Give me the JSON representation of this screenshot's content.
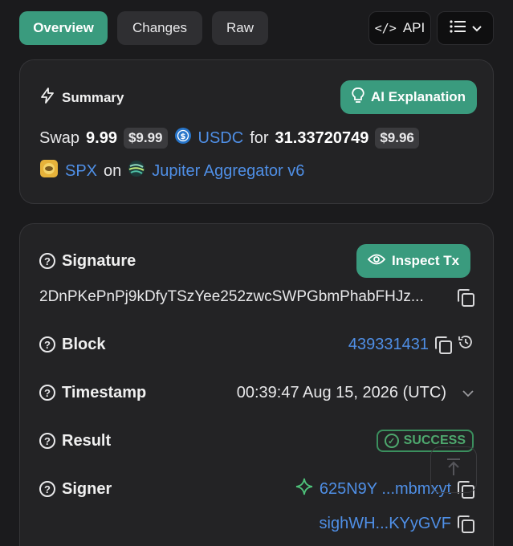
{
  "tabs": {
    "overview": "Overview",
    "changes": "Changes",
    "raw": "Raw"
  },
  "toolbar": {
    "api_label": "API",
    "api_icon": "code-icon",
    "menu_icon": "list-icon"
  },
  "summary": {
    "title": "Summary",
    "ai_button": "AI Explanation",
    "swap_word": "Swap",
    "amount_in": "9.99",
    "amount_in_usd": "$9.99",
    "token_in": "USDC",
    "for_word": "for",
    "amount_out": "31.33720749",
    "amount_out_usd": "$9.96",
    "token_out": "SPX",
    "on_word": "on",
    "program": "Jupiter Aggregator v6"
  },
  "details": {
    "inspect_button": "Inspect Tx",
    "signature_label": "Signature",
    "signature_value": "2DnPKePnPj9kDfyTSzYee252zwcSWPGbmPhabFHJz...",
    "block_label": "Block",
    "block_value": "439331431",
    "timestamp_label": "Timestamp",
    "timestamp_value": "00:39:47 Aug 15, 2026 (UTC)",
    "result_label": "Result",
    "result_value": "SUCCESS",
    "signer_label": "Signer",
    "signer_1": "625N9Y ...mbmxyt",
    "signer_2": "sighWH...KYyGVF"
  },
  "colors": {
    "accent": "#3a9b7e",
    "link": "#4f8fe6",
    "success": "#4ea86e",
    "background": "#1b1b1d",
    "card": "#232325"
  }
}
